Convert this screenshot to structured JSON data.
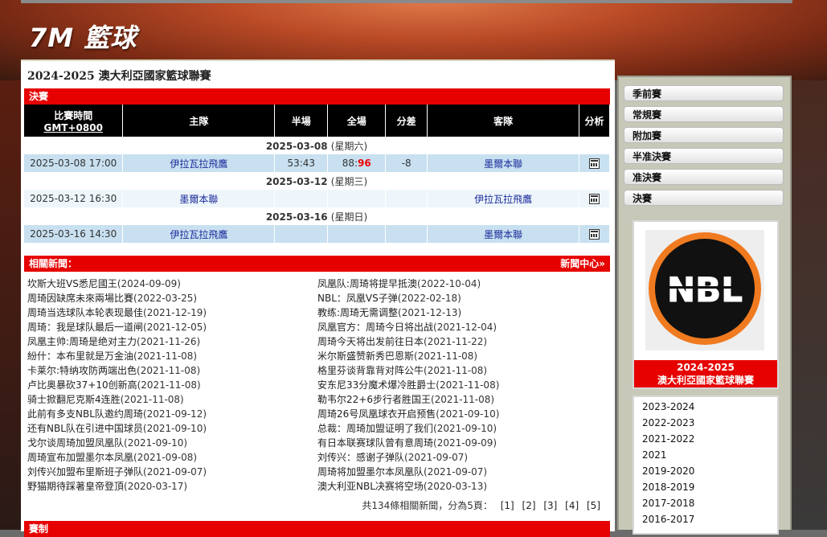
{
  "site": {
    "logo": "7M 籃球"
  },
  "page": {
    "title": "2024-2025 澳大利亞國家籃球聯賽"
  },
  "results": {
    "section": "決賽",
    "headers": {
      "time": "比賽時間",
      "tz": "GMT+0800",
      "home": "主隊",
      "half": "半場",
      "full": "全場",
      "diff": "分差",
      "away": "客隊",
      "analysis": "分析"
    },
    "groups": [
      {
        "date": "2025-03-08",
        "weekday": "(星期六)",
        "match": {
          "time": "2025-03-08 17:00",
          "home": "伊拉瓦拉飛鷹",
          "half": "53:43",
          "full_a": "88:",
          "full_b": "96",
          "diff": "-8",
          "away": "墨爾本聯"
        }
      },
      {
        "date": "2025-03-12",
        "weekday": "(星期三)",
        "match": {
          "time": "2025-03-12 16:30",
          "home": "墨爾本聯",
          "half": "",
          "full_a": "",
          "full_b": "",
          "diff": "",
          "away": "伊拉瓦拉飛鷹"
        }
      },
      {
        "date": "2025-03-16",
        "weekday": "(星期日)",
        "match": {
          "time": "2025-03-16 14:30",
          "home": "伊拉瓦拉飛鷹",
          "half": "",
          "full_a": "",
          "full_b": "",
          "diff": "",
          "away": "墨爾本聯"
        }
      }
    ]
  },
  "news": {
    "section": "相關新聞：",
    "center": "新聞中心»",
    "left": [
      {
        "t": "坎斯大班VS悉尼國王",
        "d": "(2024-09-09)"
      },
      {
        "t": "周琦因缺席未來兩場比賽",
        "d": "(2022-03-25)"
      },
      {
        "t": "周琦当选球队本轮表现最佳",
        "d": "(2021-12-19)"
      },
      {
        "t": "周琦：我是球队最后一道闸",
        "d": "(2021-12-05)"
      },
      {
        "t": "凤凰主帅:周琦是绝对主力",
        "d": "(2021-11-26)"
      },
      {
        "t": "紛什：本布里就是万金油",
        "d": "(2021-11-08)"
      },
      {
        "t": "卡莱尔:特纳攻防两端出色",
        "d": "(2021-11-08)"
      },
      {
        "t": "卢比奥暴砍37+10创新高",
        "d": "(2021-11-08)"
      },
      {
        "t": "骑士掀翻尼克斯4连胜",
        "d": "(2021-11-08)"
      },
      {
        "t": "此前有多支NBL队邀约周琦",
        "d": "(2021-09-12)"
      },
      {
        "t": "还有NBL队在引进中国球员",
        "d": "(2021-09-10)"
      },
      {
        "t": "戈尔谈周琦加盟凤凰队",
        "d": "(2021-09-10)"
      },
      {
        "t": "周琦宣布加盟墨尔本凤凰",
        "d": "(2021-09-08)"
      },
      {
        "t": "刘传兴加盟布里斯班子弹队",
        "d": "(2021-09-07)"
      },
      {
        "t": "野猫期待踩著皇帝登頂",
        "d": "(2020-03-17)"
      }
    ],
    "right": [
      {
        "t": "凤凰队:周琦将提早抵澳",
        "d": "(2022-10-04)"
      },
      {
        "t": "NBL：凤凰VS子弹",
        "d": "(2022-02-18)"
      },
      {
        "t": "教练:周琦无需调整",
        "d": "(2021-12-13)"
      },
      {
        "t": "凤凰官方：周琦今日将出战",
        "d": "(2021-12-04)"
      },
      {
        "t": "周琦今天将出发前往日本",
        "d": "(2021-11-22)"
      },
      {
        "t": "米尔斯盛赞新秀巴恩斯",
        "d": "(2021-11-08)"
      },
      {
        "t": "格里芬谈背靠背对阵公牛",
        "d": "(2021-11-08)"
      },
      {
        "t": "安东尼33分魔术爆冷胜爵士",
        "d": "(2021-11-08)"
      },
      {
        "t": "勒韦尔22+6步行者胜国王",
        "d": "(2021-11-08)"
      },
      {
        "t": "周琦26号凤凰球衣开启预售",
        "d": "(2021-09-10)"
      },
      {
        "t": "总裁：周琦加盟证明了我们",
        "d": "(2021-09-10)"
      },
      {
        "t": "有日本联赛球队曾有意周琦",
        "d": "(2021-09-09)"
      },
      {
        "t": "刘传兴：感谢子弹队",
        "d": "(2021-09-07)"
      },
      {
        "t": "周琦将加盟墨尔本凤凰队",
        "d": "(2021-09-07)"
      },
      {
        "t": "澳大利亚NBL决赛将空场",
        "d": "(2020-03-13)"
      }
    ],
    "pager": {
      "summary": "共134條相關新聞，分為5頁：",
      "pages": [
        "[1]",
        "[2]",
        "[3]",
        "[4]",
        "[5]"
      ]
    }
  },
  "next_section": "賽制",
  "sidebar": {
    "menu": [
      "季前賽",
      "常規賽",
      "附加賽",
      "半准決賽",
      "准決賽",
      "決賽"
    ],
    "badge_line1": "2024-2025",
    "badge_line2": "澳大利亞國家籃球聯賽",
    "logo_text": "NBL",
    "seasons": [
      "2023-2024",
      "2022-2023",
      "2021-2022",
      "2021",
      "2019-2020",
      "2018-2019",
      "2017-2018",
      "2016-2017"
    ]
  },
  "colors": {
    "accent": "#e60000",
    "header": "#000000",
    "row": "#c8e0f0",
    "link": "#1a2a9a"
  }
}
